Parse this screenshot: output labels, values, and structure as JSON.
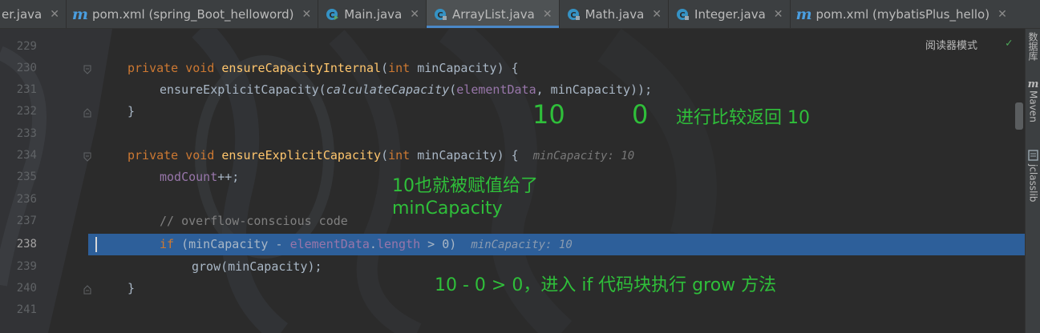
{
  "tabs": [
    {
      "label": "er.java",
      "icon": "java-class-icon",
      "active": false
    },
    {
      "label": "pom.xml (spring_Boot_helloword)",
      "icon": "maven-icon",
      "active": false
    },
    {
      "label": "Main.java",
      "icon": "java-class-run-icon",
      "active": false
    },
    {
      "label": "ArrayList.java",
      "icon": "java-class-icon",
      "active": true
    },
    {
      "label": "Math.java",
      "icon": "java-class-locked-icon",
      "active": false
    },
    {
      "label": "Integer.java",
      "icon": "java-class-locked-icon",
      "active": false
    },
    {
      "label": "pom.xml (mybatisPlus_hello)",
      "icon": "maven-icon",
      "active": false
    }
  ],
  "editor": {
    "reader_mode_label": "阅读器模式",
    "current_line": "238",
    "line_numbers": [
      "229",
      "230",
      "231",
      "232",
      "233",
      "234",
      "235",
      "236",
      "237",
      "238",
      "239",
      "240",
      "241"
    ],
    "code": {
      "l230": {
        "mod": "private",
        "type": "void",
        "name": "ensureCapacityInternal",
        "open": "(",
        "ptype": "int",
        "pname": " minCapacity) {"
      },
      "l231": {
        "call": "ensureExplicitCapacity(",
        "inner": "calculateCapacity",
        "open2": "(",
        "field": "elementData",
        "rest": ", minCapacity));"
      },
      "l232": {
        "text": "}"
      },
      "l234": {
        "mod": "private",
        "type": "void",
        "name": "ensureExplicitCapacity",
        "open": "(",
        "ptype": "int",
        "pname": " minCapacity) {",
        "hint": "minCapacity: 10"
      },
      "l235": {
        "field": "modCount",
        "rest": "++;"
      },
      "l237": {
        "comment": "// overflow-conscious code"
      },
      "l238": {
        "kw": "if",
        "a": " (minCapacity - ",
        "field": "elementData",
        "b": ".",
        "field2": "length",
        "c": " > 0)",
        "hint": "minCapacity: 10"
      },
      "l239": {
        "text": "grow(minCapacity);"
      },
      "l240": {
        "text": "}"
      }
    }
  },
  "annotations": {
    "a10": "10",
    "a0": "0",
    "compare": "进行比较返回 10",
    "assigned_1": "10也就被赋值给了",
    "assigned_2": "minCapacity",
    "enter_if": "10 - 0 > 0，进入 if 代码块执行 grow 方法"
  },
  "right_toolbar": [
    {
      "label": "数据库",
      "icon": "database-icon"
    },
    {
      "label": "Maven",
      "icon": "maven-icon"
    },
    {
      "label": "jclasslib",
      "icon": "jclasslib-icon"
    }
  ],
  "colors": {
    "annotation": "#2fbf3a",
    "keyword": "#cc7832",
    "method_decl": "#ffc66d",
    "field": "#9876aa",
    "highlight": "#2d5f9a"
  }
}
